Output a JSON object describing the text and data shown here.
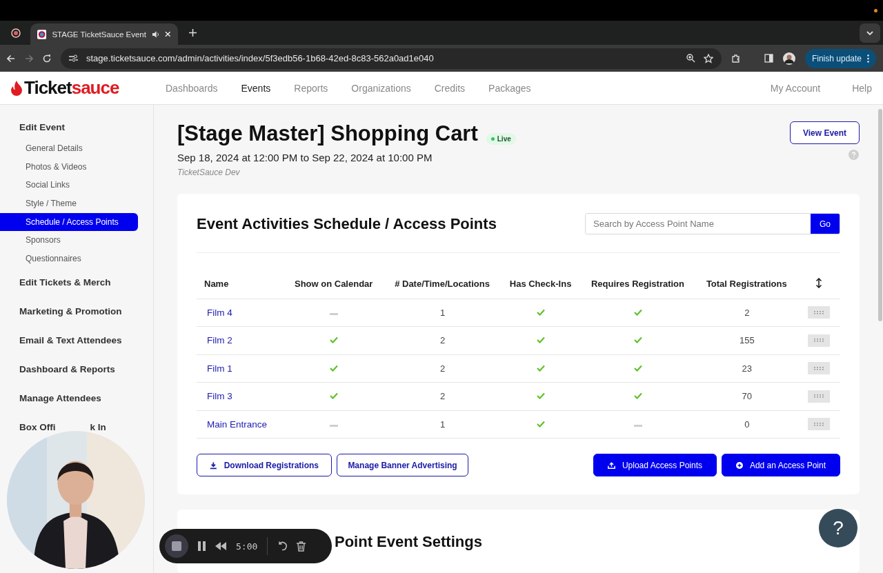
{
  "browser": {
    "tabs": [
      {
        "title": "STAGE TicketSauce Event",
        "selected": true
      }
    ],
    "url": "stage.ticketsauce.com/admin/activities/index/5f3edb56-1b68-42ed-8c83-562a0ad1e040",
    "update_button": "Finish update"
  },
  "app": {
    "logo": [
      "Ticket",
      "sauce"
    ],
    "nav": [
      {
        "label": "Dashboards",
        "selected": false
      },
      {
        "label": "Events",
        "selected": true
      },
      {
        "label": "Reports",
        "selected": false
      },
      {
        "label": "Organizations",
        "selected": false
      },
      {
        "label": "Credits",
        "selected": false
      },
      {
        "label": "Packages",
        "selected": false
      }
    ],
    "account_links": [
      "My Account",
      "Help"
    ]
  },
  "sidebar": {
    "sections": [
      {
        "label_parts": [
          "Edit Event"
        ],
        "children": [
          {
            "label": "General Details",
            "selected": false
          },
          {
            "label": "Photos & Videos",
            "selected": false
          },
          {
            "label": "Social Links",
            "selected": false
          },
          {
            "label": "Style / Theme",
            "selected": false
          },
          {
            "label": "Schedule / Access Points",
            "selected": true
          },
          {
            "label": "Sponsors",
            "selected": false
          },
          {
            "label": "Questionnaires",
            "selected": false
          }
        ]
      },
      {
        "label_parts": [
          "Edit Tickets & Merch"
        ]
      },
      {
        "label_parts": [
          "Marketing & Promotion"
        ]
      },
      {
        "label_parts": [
          "Email & Text Attendees"
        ]
      },
      {
        "label_parts": [
          "Dashboard & Reports"
        ]
      },
      {
        "label_parts": [
          "Manage Attendees"
        ]
      },
      {
        "label_parts": [
          "Box Offi",
          "k In"
        ]
      }
    ]
  },
  "event": {
    "title": "[Stage Master] Shopping Cart",
    "status": "Live",
    "dates": "Sep 18, 2024 at 12:00 PM to Sep 22, 2024 at 10:00 PM",
    "organizer": "TicketSauce Dev",
    "view_button": "View Event"
  },
  "schedule": {
    "title": "Event Activities Schedule / Access Points",
    "search": {
      "placeholder": "Search by Access Point Name",
      "button": "Go"
    },
    "columns": [
      "Name",
      "Show on Calendar",
      "# Date/Time/Locations",
      "Has Check-Ins",
      "Requires Registration",
      "Total Registrations"
    ],
    "rows": [
      {
        "name": "Film 4",
        "show_on_calendar": false,
        "locations": "1",
        "has_check_ins": true,
        "requires_registration": true,
        "total": "2"
      },
      {
        "name": "Film 2",
        "show_on_calendar": true,
        "locations": "2",
        "has_check_ins": true,
        "requires_registration": true,
        "total": "155"
      },
      {
        "name": "Film 1",
        "show_on_calendar": true,
        "locations": "2",
        "has_check_ins": true,
        "requires_registration": true,
        "total": "23"
      },
      {
        "name": "Film 3",
        "show_on_calendar": true,
        "locations": "2",
        "has_check_ins": true,
        "requires_registration": true,
        "total": "70"
      },
      {
        "name": "Main Entrance",
        "show_on_calendar": false,
        "locations": "1",
        "has_check_ins": true,
        "requires_registration": false,
        "total": "0"
      }
    ],
    "left_buttons": [
      {
        "label": "Download Registrations",
        "kind": "download"
      },
      {
        "label": "Manage Banner Advertising",
        "kind": "plain"
      }
    ],
    "right_buttons": [
      {
        "label": "Upload Access Points",
        "kind": "upload"
      },
      {
        "label": "Add an Access Point",
        "kind": "add"
      }
    ]
  },
  "settings": {
    "title": "Point Event Settings"
  },
  "recorder": {
    "time": "5:00"
  },
  "help_bubble": "?"
}
